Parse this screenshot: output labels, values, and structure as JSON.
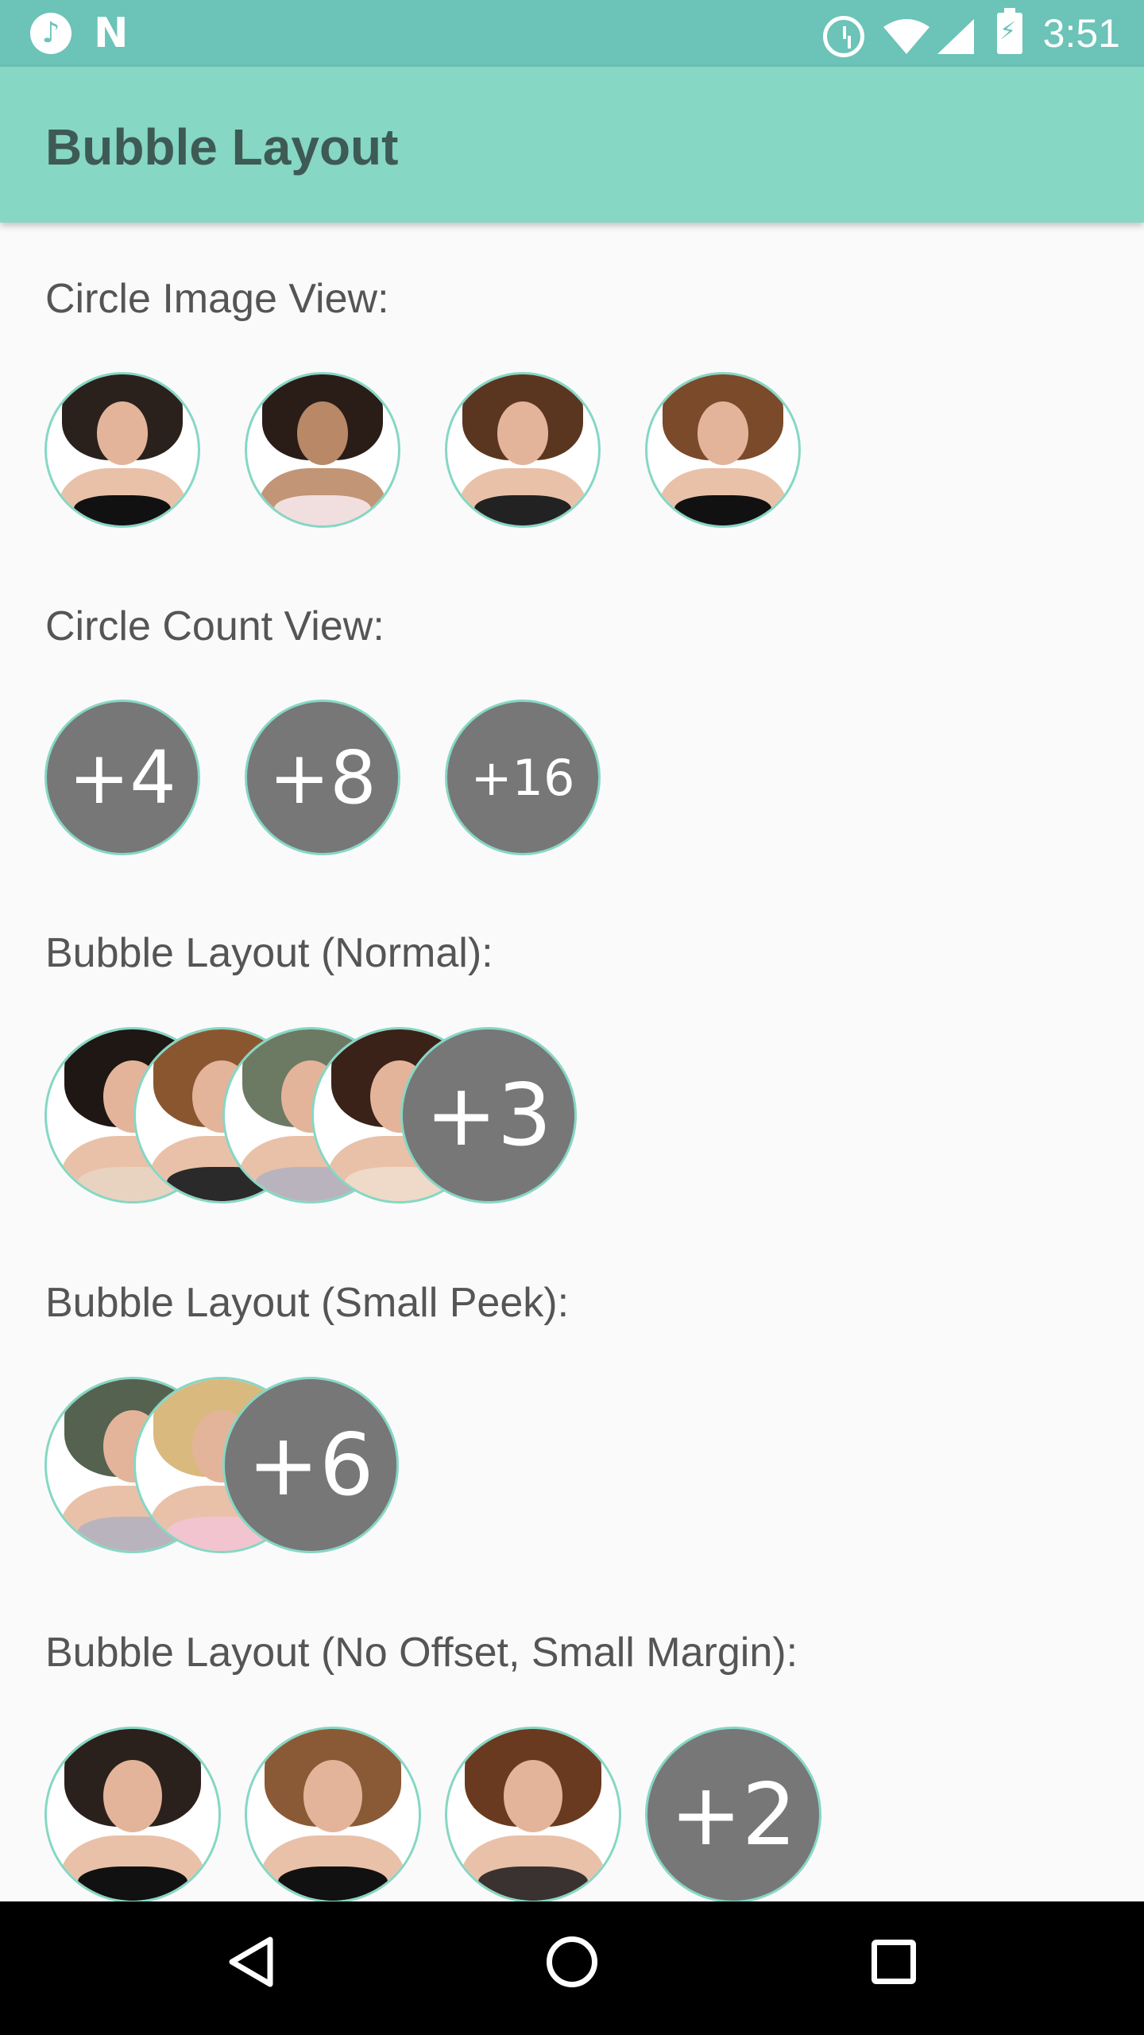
{
  "status_bar": {
    "time": "3:51",
    "icons": [
      "music-icon",
      "n-icon",
      "alarm-icon",
      "wifi-icon",
      "cell-signal-icon",
      "battery-charging-icon"
    ]
  },
  "app_bar": {
    "title": "Bubble Layout"
  },
  "sections": [
    {
      "label": "Circle Image View:"
    },
    {
      "label": "Circle Count View:",
      "counts": [
        "+4",
        "+8",
        "+16"
      ]
    },
    {
      "label": "Bubble Layout (Normal):",
      "count": "+3"
    },
    {
      "label": "Bubble Layout (Small Peek):",
      "count": "+6"
    },
    {
      "label": "Bubble Layout (No Offset, Small Margin):",
      "count": "+2"
    }
  ],
  "nav_bar": {
    "icons": [
      "back-icon",
      "home-icon",
      "recents-icon"
    ]
  },
  "colors": {
    "status_bar": "#6cc3b8",
    "app_bar": "#86d7c4",
    "ring": "#86d7c4",
    "count_bg": "#777777"
  }
}
